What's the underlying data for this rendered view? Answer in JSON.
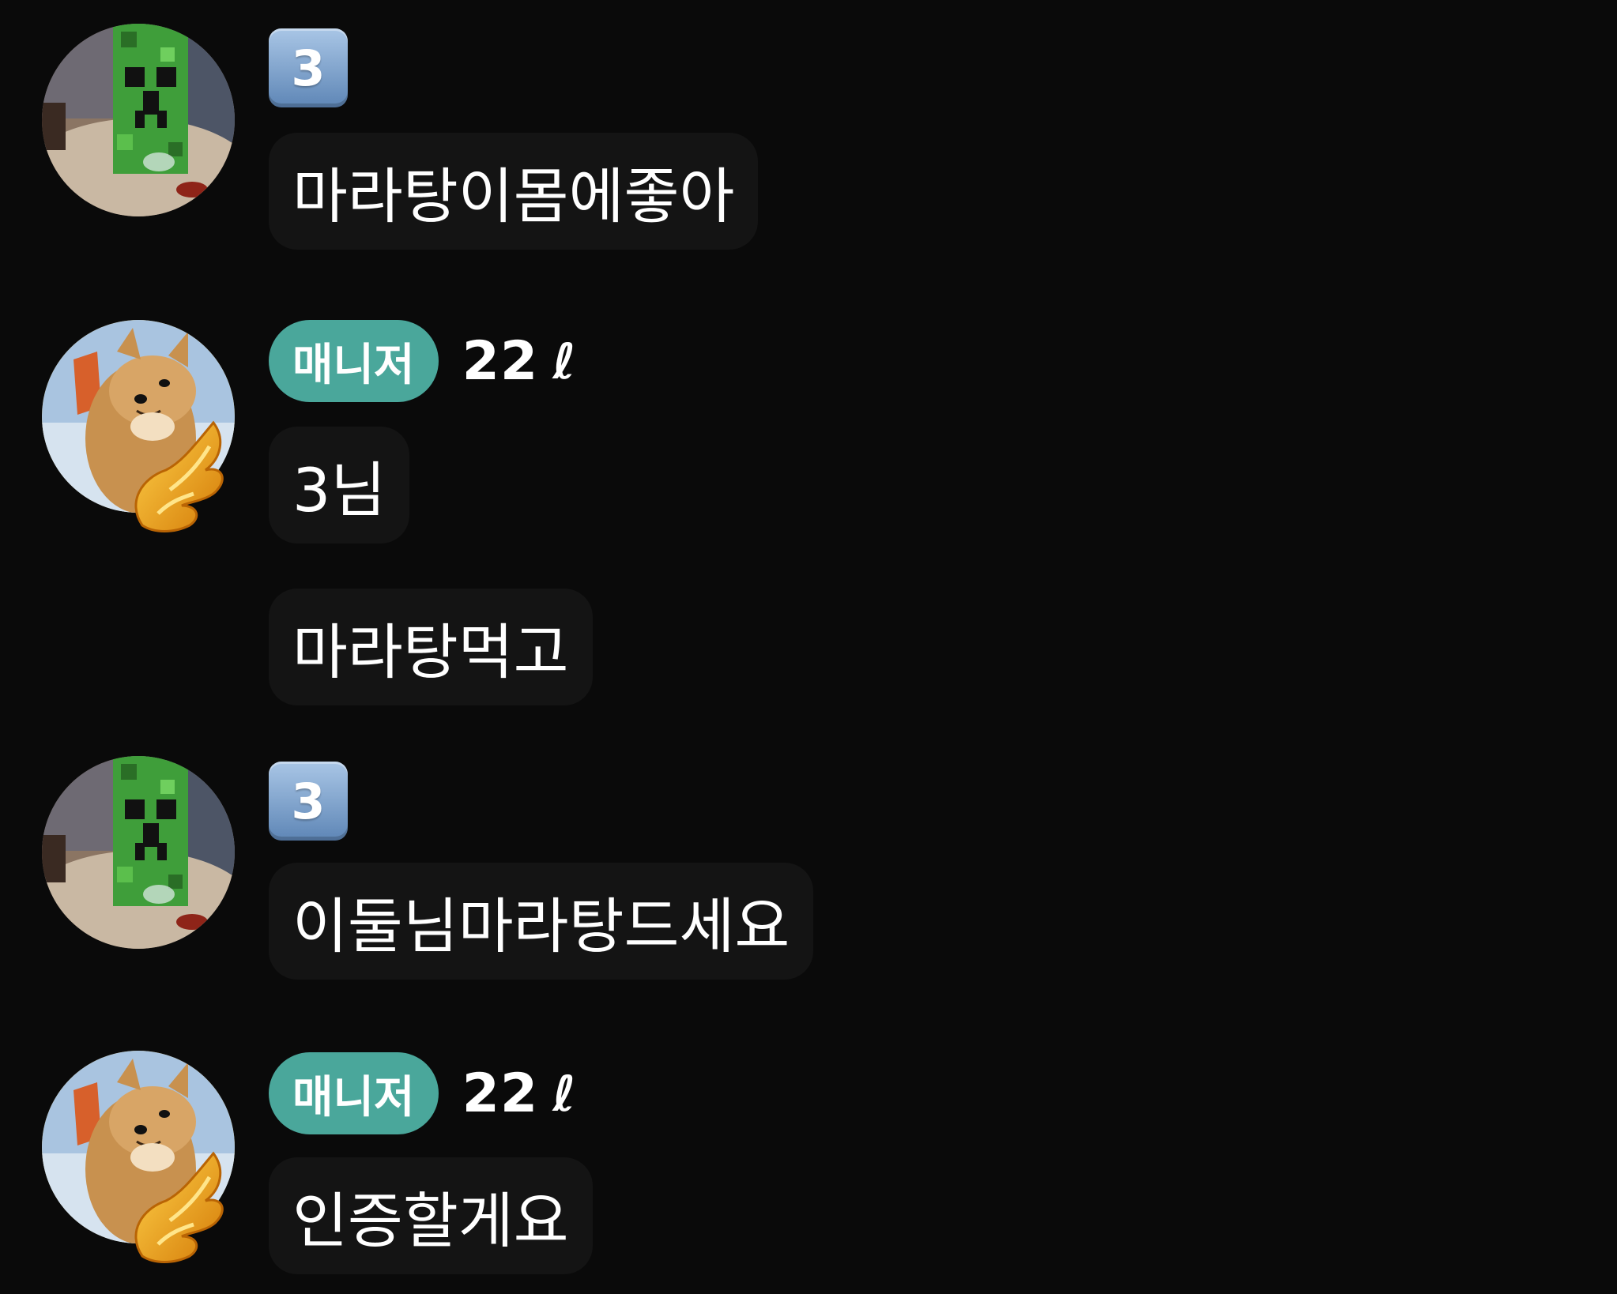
{
  "messages": [
    {
      "type": "user3",
      "badge": "3",
      "bubbles": [
        "마라탕이몸에좋아"
      ]
    },
    {
      "type": "manager",
      "role": "매니저",
      "username": "22",
      "suffix_glyph": "ℓ",
      "bubbles": [
        "3님",
        "마라탕먹고"
      ]
    },
    {
      "type": "user3",
      "badge": "3",
      "bubbles": [
        "이둘님마라탕드세요"
      ]
    },
    {
      "type": "manager",
      "role": "매니저",
      "username": "22",
      "suffix_glyph": "ℓ",
      "bubbles": [
        "인증할게요"
      ]
    }
  ],
  "colors": {
    "background": "#0a0a0a",
    "bubble": "#141414",
    "manager_badge": "#4aa79b",
    "number_badge": "#7b9fcb",
    "avatar_ring": "#e0a71f"
  },
  "icons": {
    "user3_avatar": "creeper-avatar-icon",
    "manager_avatar": "shiba-dog-avatar-icon",
    "manager_decoration": "golden-wing-icon"
  }
}
